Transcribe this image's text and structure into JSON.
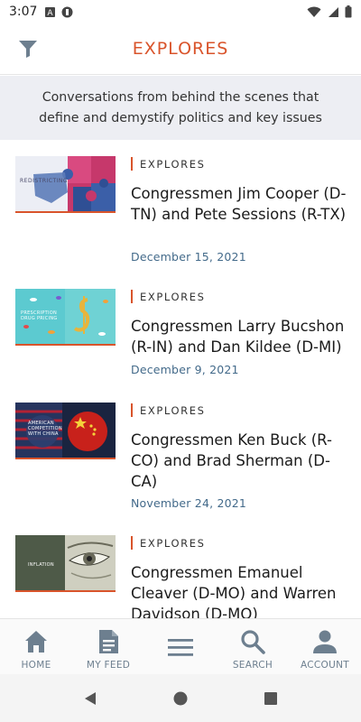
{
  "status_bar": {
    "time": "3:07",
    "icons": [
      "sim-icon",
      "notification-app-icon",
      "wifi-icon",
      "signal-icon",
      "battery-icon"
    ]
  },
  "header": {
    "title": "EXPLORES",
    "filter_icon": "filter-icon"
  },
  "intro": {
    "text": "Conversations from behind the scenes that define and demystify politics and key issues"
  },
  "colors": {
    "accent": "#d9542b",
    "date": "#436a8a",
    "nav_label": "#6d7f8f",
    "intro_bg": "#edeef3"
  },
  "feed": {
    "items": [
      {
        "tag": "EXPLORES",
        "title": "Congressmen Jim Cooper (D-TN) and Pete Sessions (R-TX)",
        "date": "December 15, 2021",
        "thumb_caption": "REDISTRICTING"
      },
      {
        "tag": "EXPLORES",
        "title": "Congressmen Larry Bucshon (R-IN) and Dan Kildee (D-MI)",
        "date": "December 9, 2021",
        "thumb_caption": "PRESCRIPTION DRUG PRICING"
      },
      {
        "tag": "EXPLORES",
        "title": "Congressmen Ken Buck (R-CO) and Brad Sherman (D-CA)",
        "date": "November 24, 2021",
        "thumb_caption": "AMERICAN COMPETITION WITH CHINA"
      },
      {
        "tag": "EXPLORES",
        "title": "Congressmen Emanuel Cleaver (D-MO) and Warren Davidson (D-MO)",
        "date": "",
        "thumb_caption": "INFLATION"
      }
    ]
  },
  "bottom_nav": {
    "items": [
      {
        "label": "HOME",
        "icon": "home-icon"
      },
      {
        "label": "MY FEED",
        "icon": "feed-icon"
      },
      {
        "label": "",
        "icon": "menu-icon"
      },
      {
        "label": "SEARCH",
        "icon": "search-icon"
      },
      {
        "label": "ACCOUNT",
        "icon": "account-icon"
      }
    ]
  },
  "system_nav": {
    "buttons": [
      "back-icon",
      "home-circle-icon",
      "recents-icon"
    ]
  }
}
